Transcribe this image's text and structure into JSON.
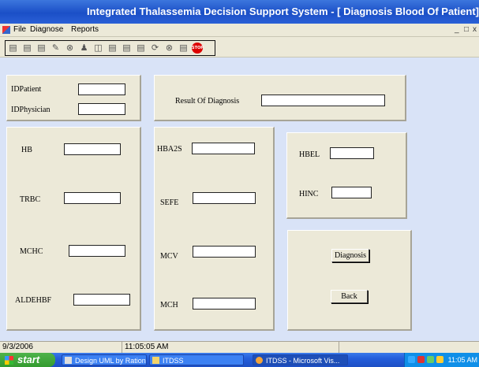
{
  "window": {
    "title": "Integrated Thalassemia Decision Support System - [  Diagnosis Blood Of Patient]"
  },
  "menu": {
    "items": [
      "File",
      "Diagnose",
      "Reports"
    ],
    "window_controls": "_   ̅̅   x"
  },
  "toolbar": {
    "buttons": [
      "save-icon",
      "edit-icon",
      "disk-icon",
      "tools-icon",
      "cancel-icon",
      "user-icon",
      "print-icon",
      "layout-icon",
      "chart-icon",
      "monitor-icon",
      "cancel-icon",
      "cancel-icon",
      "page-icon",
      "stop-icon"
    ],
    "stop_label": "STOP"
  },
  "patient_panel": {
    "id_patient_label": "IDPatient",
    "id_patient_value": "",
    "id_physician_label": "IDPhysician",
    "id_physician_value": ""
  },
  "result_panel": {
    "label": "Result Of Diagnosis",
    "value": ""
  },
  "left_panel": {
    "hb_label": "HB",
    "hb_value": "",
    "trbc_label": "TRBC",
    "trbc_value": "",
    "mchc_label": "MCHC",
    "mchc_value": "",
    "aldehbf_label": "ALDEHBF",
    "aldehbf_value": ""
  },
  "middle_panel": {
    "hba2s_label": "HBA2S",
    "hba2s_value": "",
    "sefe_label": "SEFE",
    "sefe_value": "",
    "mcv_label": "MCV",
    "mcv_value": "",
    "mch_label": "MCH",
    "mch_value": ""
  },
  "right_panel": {
    "hbel_label": "HBEL",
    "hbel_value": "",
    "hinc_label": "HINC",
    "hinc_value": ""
  },
  "actions": {
    "diagnosis_label": "Diagnosis",
    "back_label": "Back"
  },
  "status_bar": {
    "date": "9/3/2006",
    "time": "11:05:05 AM"
  },
  "taskbar": {
    "start_label": "start",
    "tasks": [
      "Design UML by Ration...",
      "ITDSS",
      "ITDSS - Microsoft Vis..."
    ],
    "clock": "11:05 AM"
  }
}
